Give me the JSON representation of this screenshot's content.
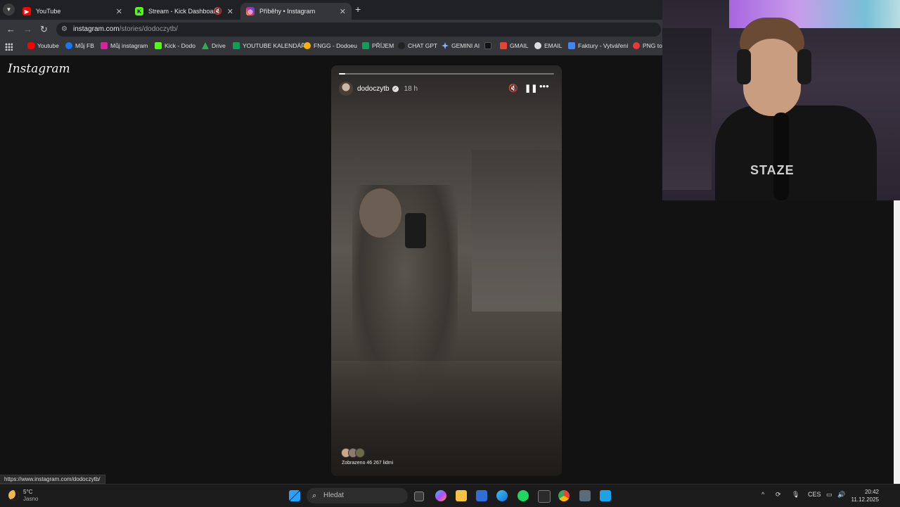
{
  "tabs": [
    {
      "title": "YouTube",
      "favicon_color": "#ff0000"
    },
    {
      "title": "Stream - Kick Dashboard",
      "favicon_color": "#53fc18"
    },
    {
      "title": "Příběhy • Instagram",
      "favicon_color": "#d6249f"
    }
  ],
  "new_tab_symbol": "+",
  "url": {
    "domain": "instagram.com",
    "path": "/stories/dodoczytb/"
  },
  "bookmarks": [
    {
      "label": "Youtube",
      "color": "#ff0000"
    },
    {
      "label": "Můj FB",
      "color": "#1877f2"
    },
    {
      "label": "Můj instagram",
      "color": "#d6249f"
    },
    {
      "label": "Kick - Dodo",
      "color": "#53fc18"
    },
    {
      "label": "Drive",
      "color": "#34a853"
    },
    {
      "label": "YOUTUBE KALENDÁŘ",
      "color": "#0f9d58"
    },
    {
      "label": "FNGG - Dodoeu",
      "color": "#f4b400"
    },
    {
      "label": "PŘÍJEM",
      "color": "#0f9d58"
    },
    {
      "label": "CHAT GPT",
      "color": "#222222"
    },
    {
      "label": "GEMINI AI",
      "color": "#8ab4f8"
    },
    {
      "label": "GMAIL",
      "color": "#ea4335"
    },
    {
      "label": "EMAIL",
      "color": "#dddddd"
    },
    {
      "label": "Faktury - Vytváření",
      "color": "#4285f4"
    },
    {
      "label": "PNG to",
      "color": "#e53935"
    }
  ],
  "instagram_logo": "Instagram",
  "story": {
    "username": "dodoczytb",
    "age": "18 h",
    "progress": 0.03,
    "viewed_text": "Zobrazeno 46 267 lidmi"
  },
  "status_url": "https://www.instagram.com/dodoczytb/",
  "taskbar": {
    "temperature": "5°C",
    "condition": "Jasno",
    "search_placeholder": "Hledat",
    "language": "CES",
    "time": "20:42",
    "date": "11.12.2025"
  },
  "webcam_shirt_text": "STAZE"
}
